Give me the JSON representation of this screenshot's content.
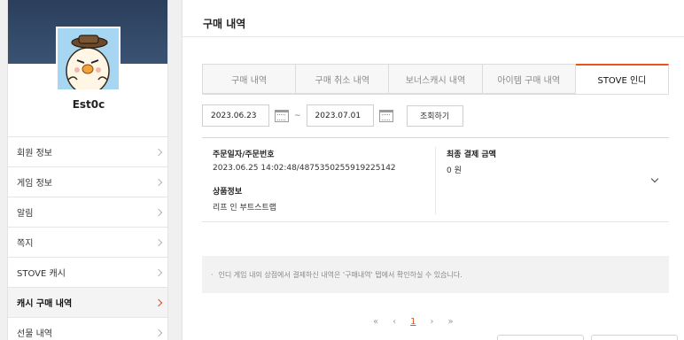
{
  "profile": {
    "username": "Est0c"
  },
  "sidebar": {
    "items": [
      {
        "label": "회원 정보"
      },
      {
        "label": "게임 정보"
      },
      {
        "label": "알림"
      },
      {
        "label": "쪽지"
      },
      {
        "label": "STOVE 캐시"
      },
      {
        "label": "캐시 구매 내역"
      },
      {
        "label": "선물 내역"
      }
    ]
  },
  "main": {
    "title": "구매 내역",
    "tabs": [
      {
        "label": "구매 내역"
      },
      {
        "label": "구매 취소 내역"
      },
      {
        "label": "보너스캐시 내역"
      },
      {
        "label": "아이템 구매 내역"
      },
      {
        "label": "STOVE 인디"
      }
    ],
    "filter": {
      "start_date": "2023.06.23",
      "separator": "~",
      "end_date": "2023.07.01",
      "search_label": "조회하기"
    },
    "order": {
      "date_label": "주문일자/주문번호",
      "date_value": "2023.06.25 14:02:48/4875350255919225142",
      "product_label": "상품정보",
      "product_value": "리프 인 부트스트랩",
      "amount_label": "최종 결제 금액",
      "amount_value": "0 원"
    },
    "notice": "인디 게임 내의 상점에서 결제하신 내역은 '구매내역' 탭에서 확인하실 수 있습니다.",
    "pagination": {
      "first": "«",
      "prev": "‹",
      "current": "1",
      "next": "›",
      "last": "»"
    }
  },
  "colors": {
    "accent": "#ea5420",
    "banner": "#2b3f5c"
  }
}
